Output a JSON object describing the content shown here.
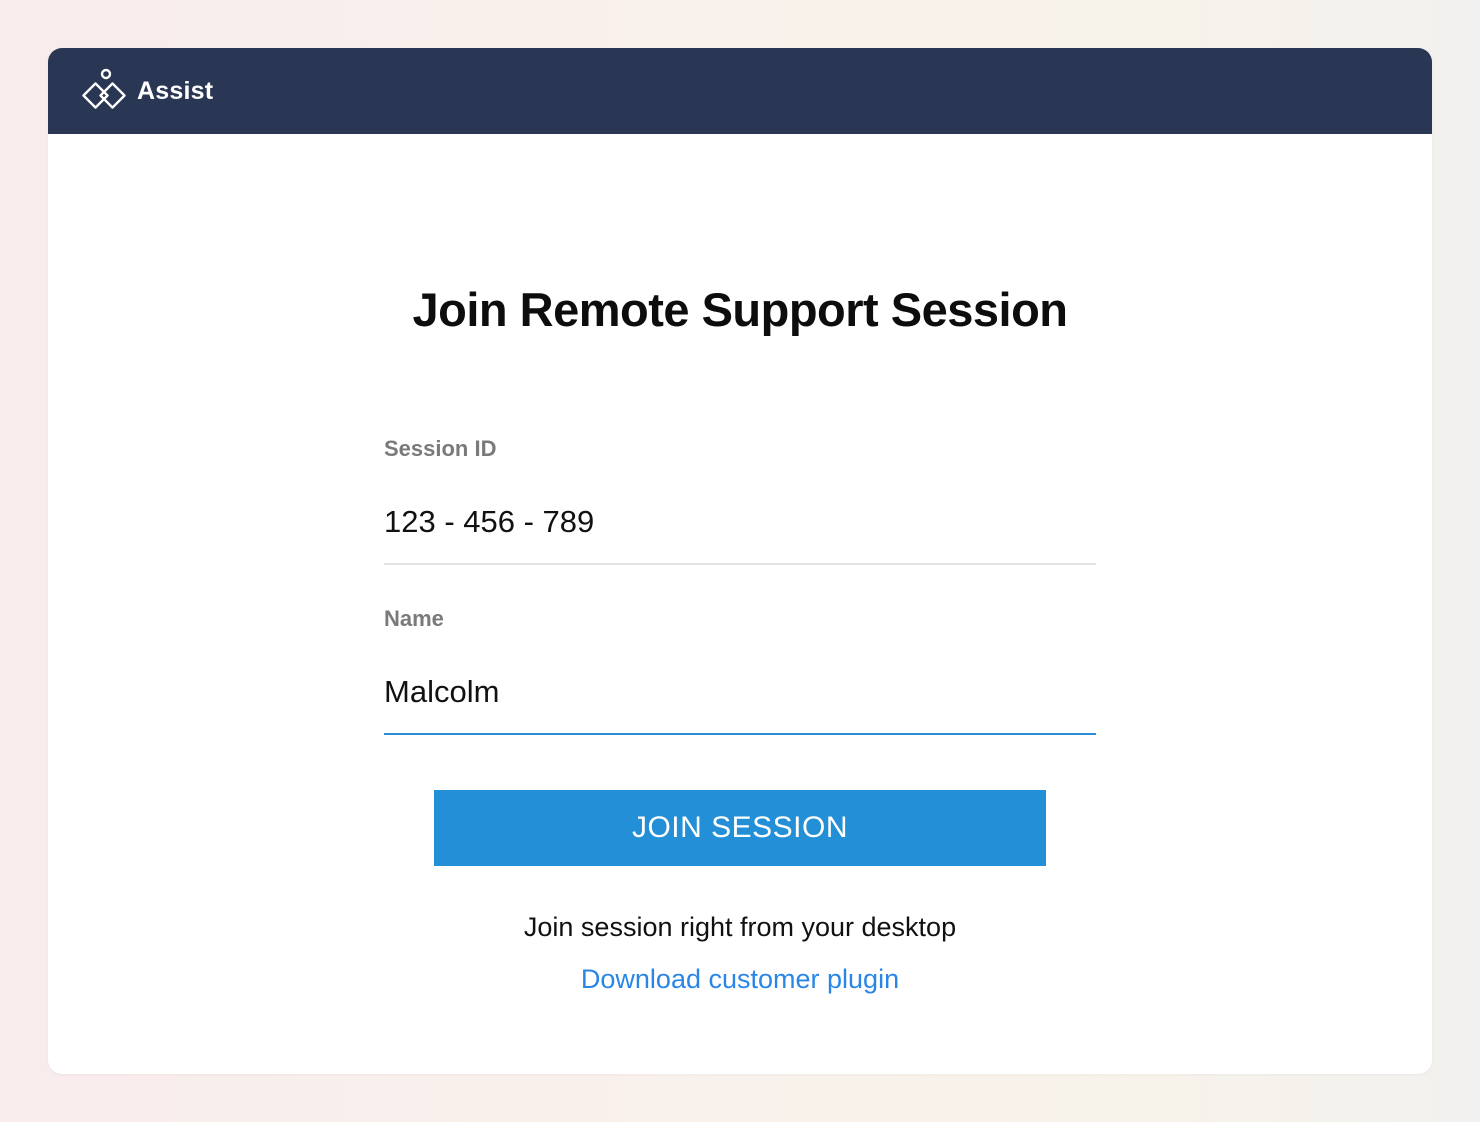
{
  "header": {
    "logo_icon": "assist-logo-icon",
    "logo_text": "Assist",
    "background": "#2a3754"
  },
  "main": {
    "title": "Join Remote Support Session",
    "session_field": {
      "label": "Session ID",
      "value": "123 - 456 - 789"
    },
    "name_field": {
      "label": "Name",
      "value": "Malcolm"
    },
    "join_button": {
      "label": "JOIN SESSION",
      "color": "#228fd7"
    },
    "hint_text": "Join session right from your desktop",
    "download_link": {
      "label": "Download customer plugin",
      "color": "#2a86e6"
    }
  }
}
